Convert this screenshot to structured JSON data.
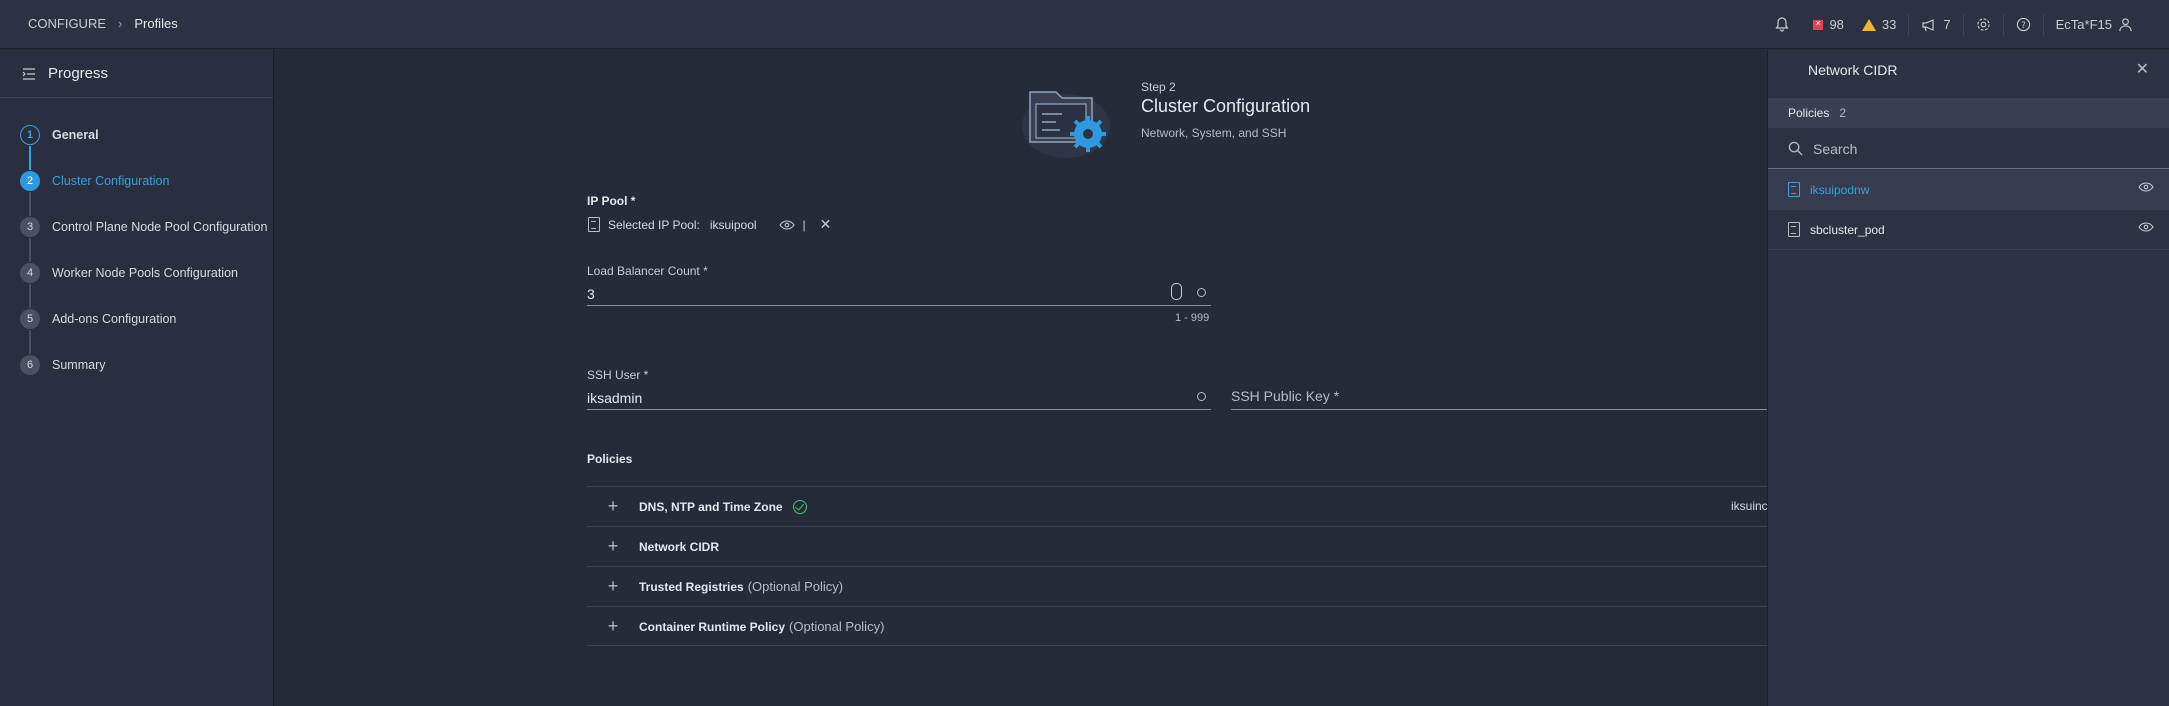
{
  "header": {
    "breadcrumb": [
      "CONFIGURE",
      "Profiles"
    ],
    "errors": "98",
    "warnings": "33",
    "announcements": "7",
    "user": "EcTa*F15"
  },
  "sidebar": {
    "title": "Progress",
    "steps": [
      {
        "num": "1",
        "label": "General"
      },
      {
        "num": "2",
        "label": "Cluster Configuration"
      },
      {
        "num": "3",
        "label": "Control Plane Node Pool Configuration"
      },
      {
        "num": "4",
        "label": "Worker Node Pools Configuration"
      },
      {
        "num": "5",
        "label": "Add-ons Configuration"
      },
      {
        "num": "6",
        "label": "Summary"
      }
    ]
  },
  "main": {
    "step_label": "Step 2",
    "title": "Cluster Configuration",
    "subtitle": "Network, System, and SSH",
    "ip_pool": {
      "label": "IP Pool *",
      "selected_prefix": "Selected IP Pool:",
      "value": "iksuipool"
    },
    "load_balancer": {
      "label": "Load Balancer Count *",
      "value": "3",
      "hint": "1 - 999"
    },
    "ssh_user": {
      "label": "SSH User *",
      "value": "iksadmin"
    },
    "ssh_key": {
      "placeholder": "SSH Public Key *"
    },
    "policies": {
      "title": "Policies",
      "rows": [
        {
          "name": "DNS, NTP and Time Zone",
          "optional": "",
          "value": "iksuinc"
        },
        {
          "name": "Network CIDR",
          "optional": "",
          "value": ""
        },
        {
          "name": "Trusted Registries",
          "optional": "(Optional Policy)",
          "value": ""
        },
        {
          "name": "Container Runtime Policy",
          "optional": "(Optional Policy)",
          "value": ""
        }
      ]
    }
  },
  "panel": {
    "title": "Network CIDR",
    "tab_label": "Policies",
    "tab_count": "2",
    "search_placeholder": "Search",
    "items": [
      {
        "name": "iksuipodnw"
      },
      {
        "name": "sbcluster_pod"
      }
    ]
  },
  "colors": {
    "accent": "#3aa0e0",
    "background": "#262b3a",
    "error": "#e04455",
    "warning": "#f2b531",
    "success": "#47c06a"
  }
}
